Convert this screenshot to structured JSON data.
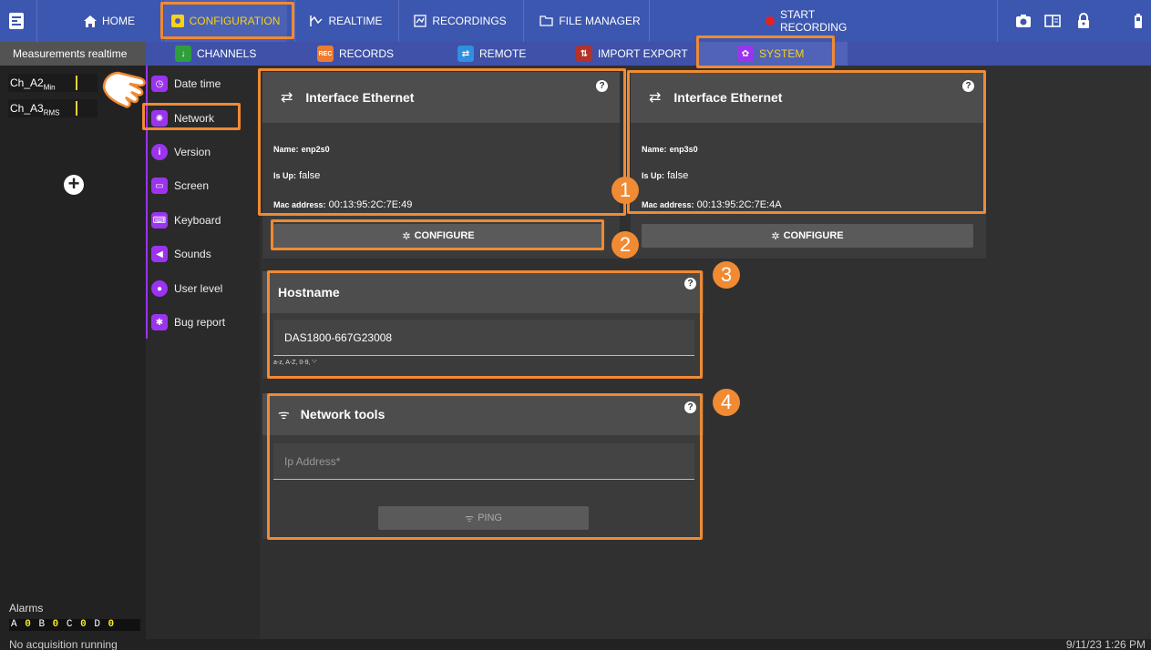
{
  "topnav": {
    "home": "HOME",
    "configuration": "CONFIGURATION",
    "realtime": "REALTIME",
    "recordings": "RECORDINGS",
    "file_manager": "FILE MANAGER",
    "start_recording": "START RECORDING"
  },
  "subnav": {
    "channels": "CHANNELS",
    "records": "RECORDS",
    "remote": "REMOTE",
    "import_export": "IMPORT EXPORT",
    "system": "SYSTEM"
  },
  "left_panel": {
    "title": "Measurements realtime",
    "channels": [
      {
        "name": "Ch_A2",
        "sub": "Min"
      },
      {
        "name": "Ch_A3",
        "sub": "RMS"
      }
    ],
    "alarms_label": "Alarms",
    "alarms": [
      {
        "letter": "A",
        "value": "0"
      },
      {
        "letter": "B",
        "value": "0"
      },
      {
        "letter": "C",
        "value": "0"
      },
      {
        "letter": "D",
        "value": "0"
      }
    ]
  },
  "system_menu": [
    {
      "label": "Date time",
      "icon": "clock-icon"
    },
    {
      "label": "Network",
      "icon": "network-icon"
    },
    {
      "label": "Version",
      "icon": "info-icon"
    },
    {
      "label": "Screen",
      "icon": "monitor-icon"
    },
    {
      "label": "Keyboard",
      "icon": "keyboard-icon"
    },
    {
      "label": "Sounds",
      "icon": "speaker-icon"
    },
    {
      "label": "User level",
      "icon": "user-icon"
    },
    {
      "label": "Bug report",
      "icon": "bug-icon"
    }
  ],
  "interfaces": [
    {
      "title": "Interface Ethernet",
      "name_label": "Name:",
      "name": "enp2s0",
      "up_label": "Is Up:",
      "up": "false",
      "mac_label": "Mac address:",
      "mac": "00:13:95:2C:7E:49",
      "configure": "CONFIGURE"
    },
    {
      "title": "Interface Ethernet",
      "name_label": "Name:",
      "name": "enp3s0",
      "up_label": "Is Up:",
      "up": "false",
      "mac_label": "Mac address:",
      "mac": "00:13:95:2C:7E:4A",
      "configure": "CONFIGURE"
    }
  ],
  "hostname": {
    "title": "Hostname",
    "value": "DAS1800-667G23008",
    "hint": "a-z, A-Z, 0-9, '-'"
  },
  "network_tools": {
    "title": "Network tools",
    "ip_placeholder": "Ip Address*",
    "ping": "PING"
  },
  "annotations": [
    "1",
    "2",
    "3",
    "4"
  ],
  "status": {
    "left": "No acquisition running",
    "right": "9/11/23 1:26 PM"
  },
  "colors": {
    "topbar": "#3c57b0",
    "accent_yellow": "#f6d21a",
    "highlight_orange": "#f08a33",
    "purple": "#9b34ef"
  }
}
